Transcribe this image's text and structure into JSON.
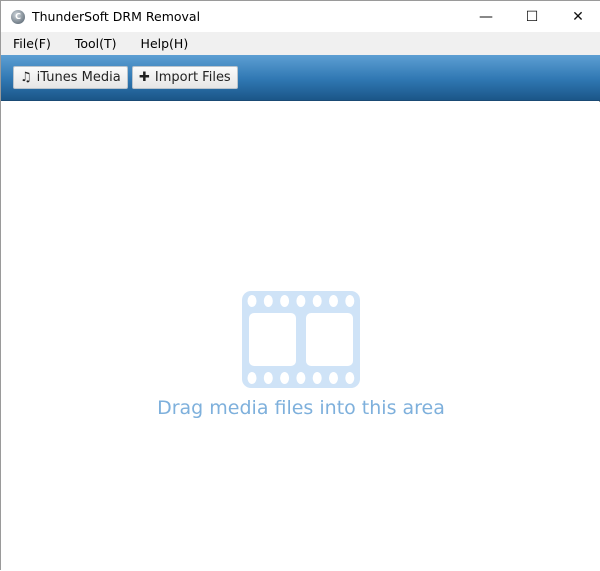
{
  "window": {
    "title": "ThunderSoft DRM Removal",
    "minimize": "—",
    "maximize": "☐",
    "close": "✕"
  },
  "menu": [
    {
      "label": "File(F)"
    },
    {
      "label": "Tool(T)"
    },
    {
      "label": "Help(H)"
    }
  ],
  "toolbar": {
    "itunes_label": "iTunes Media",
    "itunes_icon": "♫",
    "import_label": "Import Files",
    "import_icon": "✚"
  },
  "drop_area": {
    "text": "Drag media files into this area",
    "icon": "film-icon",
    "color": "#7eb0dc"
  }
}
